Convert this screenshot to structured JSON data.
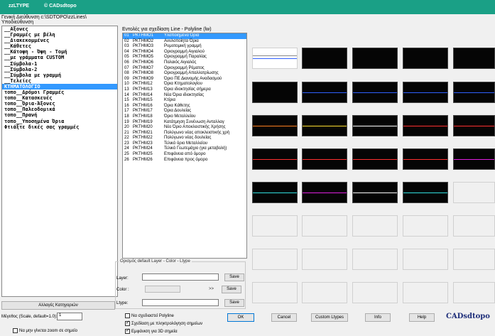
{
  "window": {
    "app_name": "zzLTYPE",
    "copyright": "© CADsdtopo"
  },
  "path_label": "Γενική Διεύθυνση c:\\SDTOPO\\zzLines\\",
  "categories_label": "Υποδιεύθυνση",
  "categories": [
    "__Αξονες",
    "__Γραμμές με βέλη",
    "__Διακεκομμένες",
    "__Κάθετες",
    "__Κάτοψη - Όψη - Τομή",
    "__με γράμματα CUSTOM",
    "__Σύμβολα-1",
    "__Σύμβολα-2",
    "__Σύμβολα με γραμμή",
    "__Τελείες",
    "ΚΤΗΜΑΤΟΛΟΓΙΟ",
    "τοπο__Δρόμοι Γραμμές",
    "τοπο__Κατασκευές",
    "τοπο__Όρια-Άξονες",
    "τοπο__Παλεοδομικά",
    "τοπο__Πρανή",
    "τοπο__Υποσημένα Όρια",
    "Φτιάξτε δικές σας γραμμές"
  ],
  "selected_category_index": 10,
  "commands_label": "Εντολές για σχεδίαση Line - Polyline (lw)",
  "commands": [
    {
      "num": "01",
      "code": "PKTHMO1",
      "desc": "Υλοποιημένα Όρια"
    },
    {
      "num": "02",
      "code": "PKTHMO2",
      "desc": "Ανυλοποίητα Όρια"
    },
    {
      "num": "03",
      "code": "PKTHMO3",
      "desc": "Ρυμοτομική γραμμή"
    },
    {
      "num": "04",
      "code": "PKTHMO4",
      "desc": "Οριογραμμή Αιγιαλού"
    },
    {
      "num": "05",
      "code": "PKTHMO5",
      "desc": "Οριογραμμή Παραλίας"
    },
    {
      "num": "06",
      "code": "PKTHMO6",
      "desc": "Παλαιός Αιγιαλός"
    },
    {
      "num": "07",
      "code": "PKTHMO7",
      "desc": "Οριογραμμή Ρέματος"
    },
    {
      "num": "08",
      "code": "PKTHMO8",
      "desc": "Οριογραμμή Απαλλοτρίωσης"
    },
    {
      "num": "09",
      "code": "PKTHMO9",
      "desc": "Όριο ΠΕ Διανομής Αναδασμού"
    },
    {
      "num": "10",
      "code": "PKTHM12",
      "desc": "Όρια Κτηματολογίου"
    },
    {
      "num": "13",
      "code": "PKTHM13",
      "desc": "Όρια ιδιοκτησίας σήμερα"
    },
    {
      "num": "14",
      "code": "PKTHM14",
      "desc": "Νέα Όρια ιδιοκτησίας"
    },
    {
      "num": "15",
      "code": "PKTHM15",
      "desc": "Κτίρια"
    },
    {
      "num": "16",
      "code": "PKTHM16",
      "desc": "Όρια Κάθετης"
    },
    {
      "num": "17",
      "code": "PKTHM17",
      "desc": "Όρια Δουλείας"
    },
    {
      "num": "18",
      "code": "PKTHM18",
      "desc": "Όριο Μεταλλείου"
    },
    {
      "num": "19",
      "code": "PKTHM19",
      "desc": "Κατάτμηση Συνένωση Ανταλλαγ"
    },
    {
      "num": "20",
      "code": "PKTHM20",
      "desc": "Νέο Όριο Αποκλειστικής Χρήσης"
    },
    {
      "num": "21",
      "code": "PKTHM21",
      "desc": "Πολύγωνο νέας αποκλειστικής χρή"
    },
    {
      "num": "22",
      "code": "PKTHM22",
      "desc": "Πολύγωνο νέας δουλείας"
    },
    {
      "num": "23",
      "code": "PKTHM23",
      "desc": "Τελικό όριο Μεταλλείου"
    },
    {
      "num": "24",
      "code": "PKTHM24",
      "desc": "Τελικό Γεωτεμάχιο (για μεταβολή)"
    },
    {
      "num": "25",
      "code": "PKTHM25",
      "desc": "Επιφάνεια από όμορο"
    },
    {
      "num": "26",
      "code": "PKTHM26",
      "desc": "Επιφάνεια προς όμορο"
    }
  ],
  "defaults_group": {
    "title": "Ορισμός default Layer - Color - Ltype",
    "layer_label": "Layer:",
    "color_label": "Color :",
    "ltype_label": "Ltype:",
    "arrows": ">>",
    "save_label": "Save",
    "layer_value": "",
    "ltype_value": ""
  },
  "change_categories_label": "Αλλαγές Κατηγοριών",
  "scale_label": "Μέγεθος (Scale, default=1.0):",
  "scale_value": "1",
  "zoom_checkbox": {
    "label": "Να μην γίνεται zoom σε σημείο",
    "checked": false
  },
  "options": [
    {
      "label": "Να σχεδιαστεί Polyline",
      "checked": false
    },
    {
      "label": "Σχεδίαση με πληκτρολόγηση σημείων",
      "checked": true
    },
    {
      "label": "Εμφάνιση για 3D σημεία",
      "checked": true
    }
  ],
  "buttons": {
    "ok": "OK",
    "cancel": "Cancel",
    "custom": "Custom Ltypes",
    "info": "Info",
    "help": "Help"
  },
  "logo": "CADsdtopo",
  "preview_colors": {
    "white": "#ffffff",
    "red": "#ff3030",
    "green": "#20d040",
    "blue": "#3060ff",
    "yellow": "#ffe030",
    "magenta": "#e020e0",
    "cyan": "#30e0e0",
    "orange": "#ff8020"
  }
}
